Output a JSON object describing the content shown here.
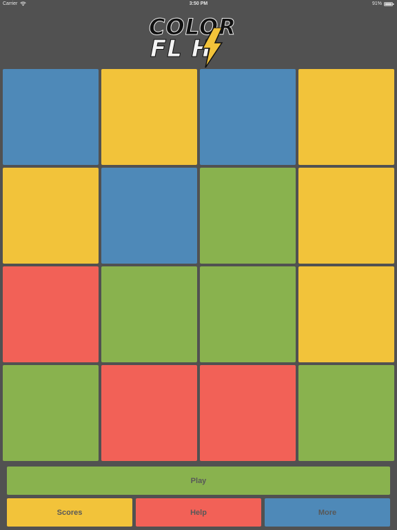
{
  "status_bar": {
    "carrier": "Carrier",
    "time": "3:50 PM",
    "battery": "91%",
    "wifi_icon": "wifi-icon",
    "battery_icon": "battery-icon"
  },
  "logo": {
    "line1": "COLOR",
    "line2": "FL  H",
    "bolt_icon": "lightning-bolt-icon",
    "bolt_color": "#f2c33a"
  },
  "colors": {
    "blue": "#4e89b8",
    "yellow": "#f2c33a",
    "green": "#89b24e",
    "red": "#f26157",
    "background": "#515151"
  },
  "grid": [
    [
      "blue",
      "yellow",
      "blue",
      "yellow"
    ],
    [
      "yellow",
      "blue",
      "green",
      "yellow"
    ],
    [
      "red",
      "green",
      "green",
      "yellow"
    ],
    [
      "green",
      "red",
      "red",
      "green"
    ]
  ],
  "buttons": {
    "play": {
      "label": "Play",
      "color": "green"
    },
    "scores": {
      "label": "Scores",
      "color": "yellow"
    },
    "help": {
      "label": "Help",
      "color": "red"
    },
    "more": {
      "label": "More",
      "color": "blue"
    }
  }
}
